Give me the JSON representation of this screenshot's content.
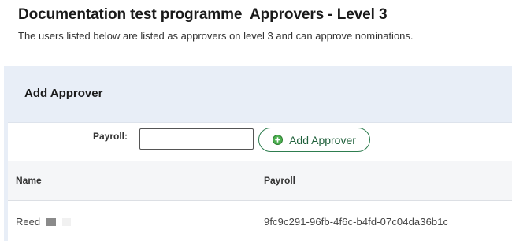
{
  "page": {
    "title": "Documentation test programme  Approvers - Level 3",
    "subtitle": "The users listed below are listed as approvers on level 3 and can approve nominations."
  },
  "add_approver": {
    "heading": "Add Approver",
    "payroll_label": "Payroll:",
    "payroll_value": "",
    "button_label": "Add Approver",
    "button_icon": "plus-circle-icon",
    "accent_color": "#2e7d4f"
  },
  "approvers_table": {
    "columns": [
      "Name",
      "Payroll"
    ],
    "rows": [
      {
        "name": "Reed",
        "payroll": "9fc9c291-96fb-4f6c-b4fd-07c04da36b1c"
      }
    ]
  }
}
